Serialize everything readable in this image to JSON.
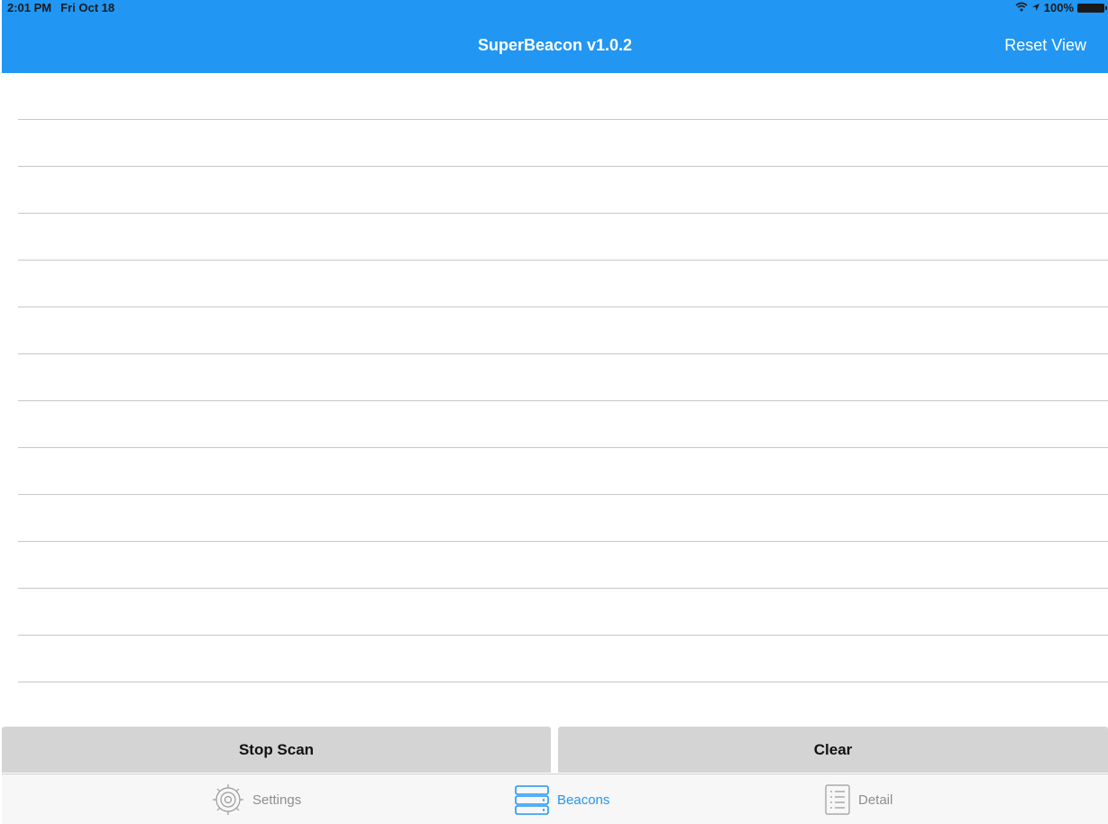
{
  "status_bar": {
    "time": "2:01 PM",
    "date": "Fri Oct 18",
    "battery": "100%",
    "icons": [
      "wifi-icon",
      "location-icon",
      "battery-icon"
    ]
  },
  "nav": {
    "title": "SuperBeacon v1.0.2",
    "reset_label": "Reset View"
  },
  "list": {
    "rows": [
      "",
      "",
      "",
      "",
      "",
      "",
      "",
      "",
      "",
      "",
      "",
      "",
      ""
    ]
  },
  "actions": {
    "stop_scan_label": "Stop Scan",
    "clear_label": "Clear"
  },
  "tabs": [
    {
      "label": "Settings",
      "icon": "settings-gear-icon",
      "active": false
    },
    {
      "label": "Beacons",
      "icon": "beacons-stack-icon",
      "active": true
    },
    {
      "label": "Detail",
      "icon": "detail-list-icon",
      "active": false
    }
  ],
  "colors": {
    "accent": "#2196f3",
    "inactive_tab": "#8e8e8e",
    "button_bg": "#d4d4d4",
    "separator": "#c8c8c8"
  }
}
